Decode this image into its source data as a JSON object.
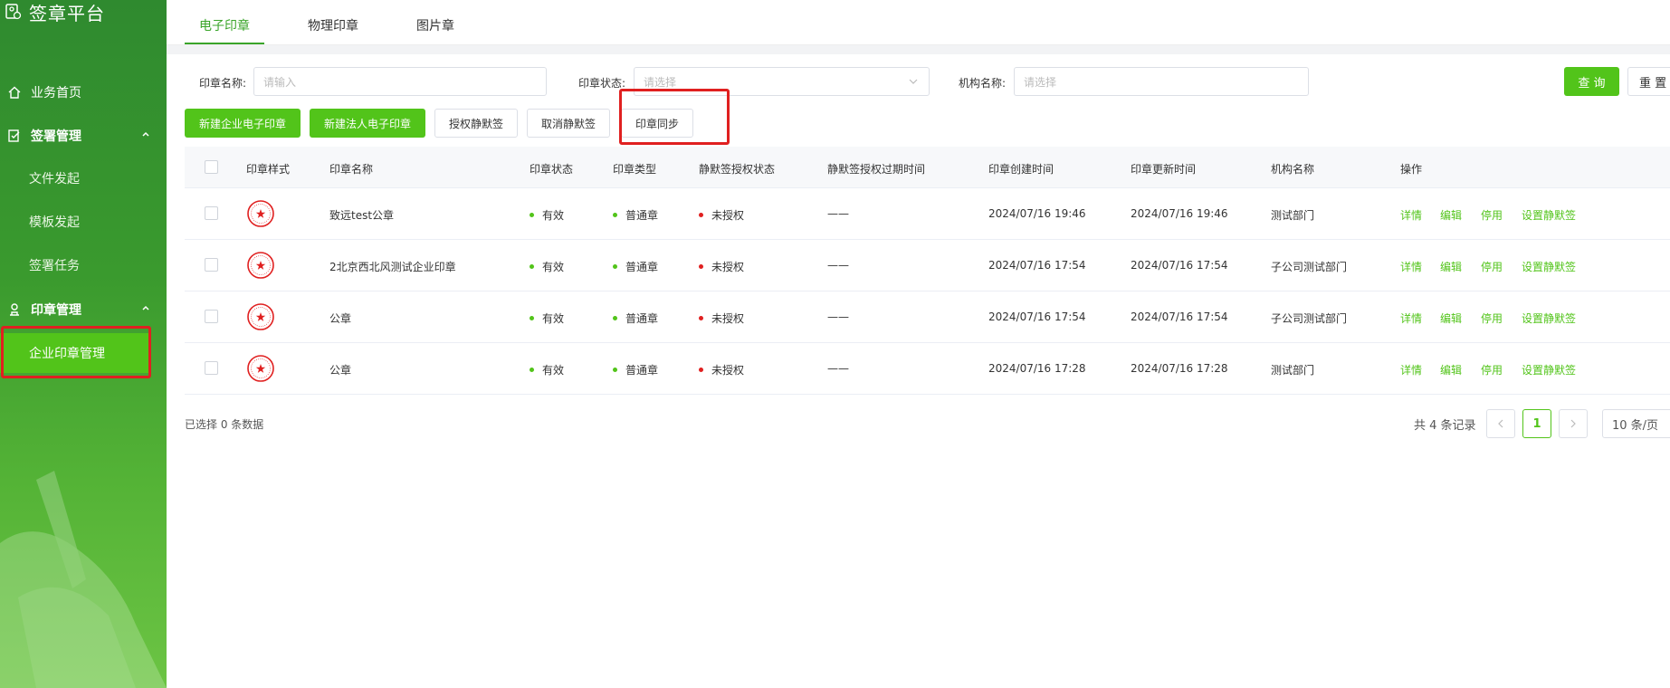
{
  "app": {
    "title": "签章平台"
  },
  "sidebar": {
    "home": "业务首页",
    "sign_group": "签署管理",
    "sign_items": [
      "文件发起",
      "模板发起",
      "签署任务"
    ],
    "seal_group": "印章管理",
    "seal_items": [
      "企业印章管理"
    ]
  },
  "tabs": [
    "电子印章",
    "物理印章",
    "图片章"
  ],
  "filters": {
    "seal_name_label": "印章名称:",
    "seal_name_placeholder": "请输入",
    "seal_status_label": "印章状态:",
    "seal_status_placeholder": "请选择",
    "org_label": "机构名称:",
    "org_placeholder": "请选择",
    "query": "查 询",
    "reset": "重 置"
  },
  "actions": [
    "新建企业电子印章",
    "新建法人电子印章",
    "授权静默签",
    "取消静默签",
    "印章同步"
  ],
  "table": {
    "columns": [
      "印章样式",
      "印章名称",
      "印章状态",
      "印章类型",
      "静默签授权状态",
      "静默签授权过期时间",
      "印章创建时间",
      "印章更新时间",
      "机构名称",
      "操作"
    ],
    "rows": [
      {
        "name": "致远test公章",
        "status": "有效",
        "type": "普通章",
        "auth": "未授权",
        "expire": "——",
        "created": "2024/07/16 19:46",
        "updated": "2024/07/16 19:46",
        "org": "测试部门"
      },
      {
        "name": "2北京西北风测试企业印章",
        "status": "有效",
        "type": "普通章",
        "auth": "未授权",
        "expire": "——",
        "created": "2024/07/16 17:54",
        "updated": "2024/07/16 17:54",
        "org": "子公司测试部门"
      },
      {
        "name": "公章",
        "status": "有效",
        "type": "普通章",
        "auth": "未授权",
        "expire": "——",
        "created": "2024/07/16 17:54",
        "updated": "2024/07/16 17:54",
        "org": "子公司测试部门"
      },
      {
        "name": "公章",
        "status": "有效",
        "type": "普通章",
        "auth": "未授权",
        "expire": "——",
        "created": "2024/07/16 17:28",
        "updated": "2024/07/16 17:28",
        "org": "测试部门"
      }
    ],
    "ops": [
      "详情",
      "编辑",
      "停用",
      "设置静默签"
    ]
  },
  "footer": {
    "selected": "已选择 0 条数据",
    "total": "共 4 条记录",
    "page": "1",
    "page_size": "10 条/页"
  },
  "colors": {
    "accent": "#52c41a",
    "danger": "#e02020",
    "valid": "#52c41a",
    "unauth": "#e02020"
  }
}
